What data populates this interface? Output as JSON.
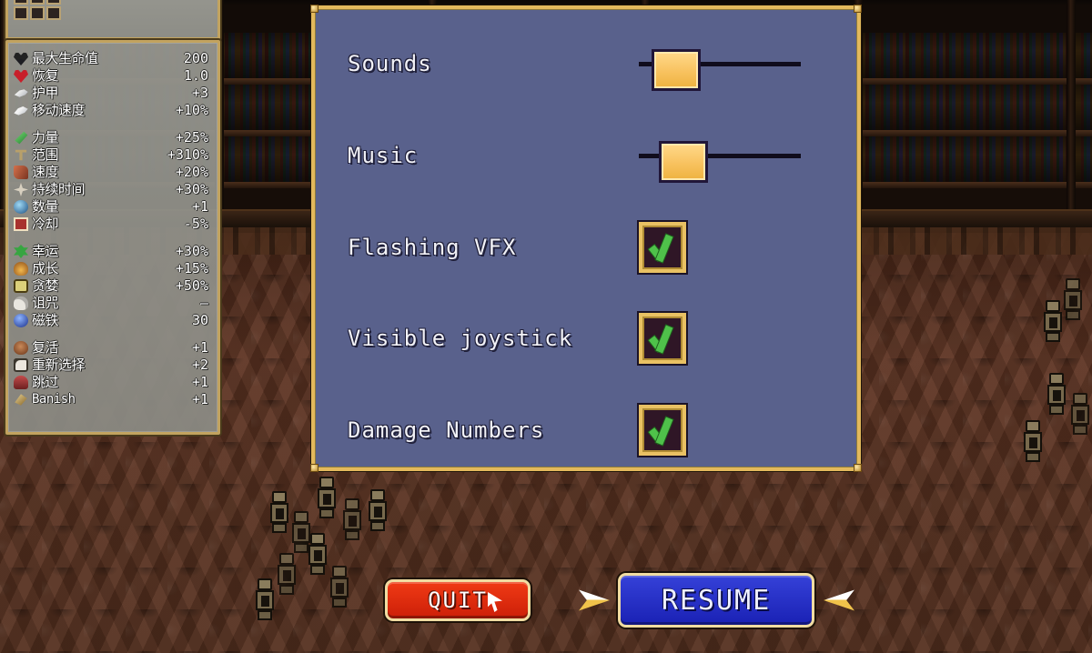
{
  "window": {
    "title": "Vampire Survivors - Pause Menu",
    "background_scene": "library-room"
  },
  "colors": {
    "panel_bg": "#59618c",
    "panel_border_gold": "#e3b95c",
    "slider_handle": "#f8c25f",
    "check_green": "#4fc14a",
    "quit_red": "#e62e10",
    "resume_blue": "#2a33cf",
    "stats_panel_bg": "#939390",
    "stats_border": "#c2a35f",
    "floor_brown": "#5d3322"
  },
  "stats_panel": {
    "groups": [
      {
        "rows": [
          {
            "icon": "dark-heart-icon",
            "icon_class": "ic-heart-dark",
            "name": "最大生命值",
            "value": "200"
          },
          {
            "icon": "red-heart-icon",
            "icon_class": "ic-heart-red",
            "name": "恢复",
            "value": "1.0"
          },
          {
            "icon": "armor-wing-icon",
            "icon_class": "ic-wing",
            "name": "护甲",
            "value": "+3"
          },
          {
            "icon": "move-speed-wings-icon",
            "icon_class": "ic-wings",
            "name": "移动速度",
            "value": "+10%"
          }
        ]
      },
      {
        "rows": [
          {
            "icon": "might-leaf-icon",
            "icon_class": "ic-leaf",
            "name": "力量",
            "value": "+25%"
          },
          {
            "icon": "area-icon",
            "icon_class": "ic-area",
            "name": "范围",
            "value": "+310%"
          },
          {
            "icon": "speed-icon",
            "icon_class": "ic-speed",
            "name": "速度",
            "value": "+20%"
          },
          {
            "icon": "duration-icon",
            "icon_class": "ic-dur",
            "name": "持续时间",
            "value": "+30%"
          },
          {
            "icon": "amount-icon",
            "icon_class": "ic-amt",
            "name": "数量",
            "value": "+1"
          },
          {
            "icon": "cooldown-icon",
            "icon_class": "ic-cd",
            "name": "冷却",
            "value": "-5%"
          }
        ]
      },
      {
        "rows": [
          {
            "icon": "luck-clover-icon",
            "icon_class": "ic-luck",
            "name": "幸运",
            "value": "+30%"
          },
          {
            "icon": "growth-icon",
            "icon_class": "ic-growth",
            "name": "成长",
            "value": "+15%"
          },
          {
            "icon": "greed-icon",
            "icon_class": "ic-greed",
            "name": "贪婪",
            "value": "+50%"
          },
          {
            "icon": "curse-skull-icon",
            "icon_class": "ic-curse",
            "name": "诅咒",
            "value": "–"
          },
          {
            "icon": "magnet-icon",
            "icon_class": "ic-magnet",
            "name": "磁铁",
            "value": "30"
          }
        ]
      },
      {
        "rows": [
          {
            "icon": "revival-icon",
            "icon_class": "ic-revival",
            "name": "复活",
            "value": "+1"
          },
          {
            "icon": "reroll-dice-icon",
            "icon_class": "ic-reroll",
            "name": "重新选择",
            "value": "+2"
          },
          {
            "icon": "skip-icon",
            "icon_class": "ic-skip",
            "name": "跳过",
            "value": "+1"
          },
          {
            "icon": "banish-icon",
            "icon_class": "ic-banish",
            "name": "Banish",
            "value": "+1",
            "latin": true
          }
        ]
      }
    ]
  },
  "settings": {
    "options": [
      {
        "label": "Sounds",
        "type": "slider",
        "handle_pct": 8,
        "control_name": "sounds-slider"
      },
      {
        "label": "Music",
        "type": "slider",
        "handle_pct": 16,
        "control_name": "music-slider"
      },
      {
        "label": "Flashing VFX",
        "type": "checkbox",
        "checked": true,
        "control_name": "flashing-vfx-checkbox"
      },
      {
        "label": "Visible joystick",
        "type": "checkbox",
        "checked": true,
        "control_name": "visible-joystick-checkbox"
      },
      {
        "label": "Damage Numbers",
        "type": "checkbox",
        "checked": true,
        "control_name": "damage-numbers-checkbox"
      }
    ]
  },
  "buttons": {
    "quit": "QUIT",
    "resume": "RESUME"
  }
}
